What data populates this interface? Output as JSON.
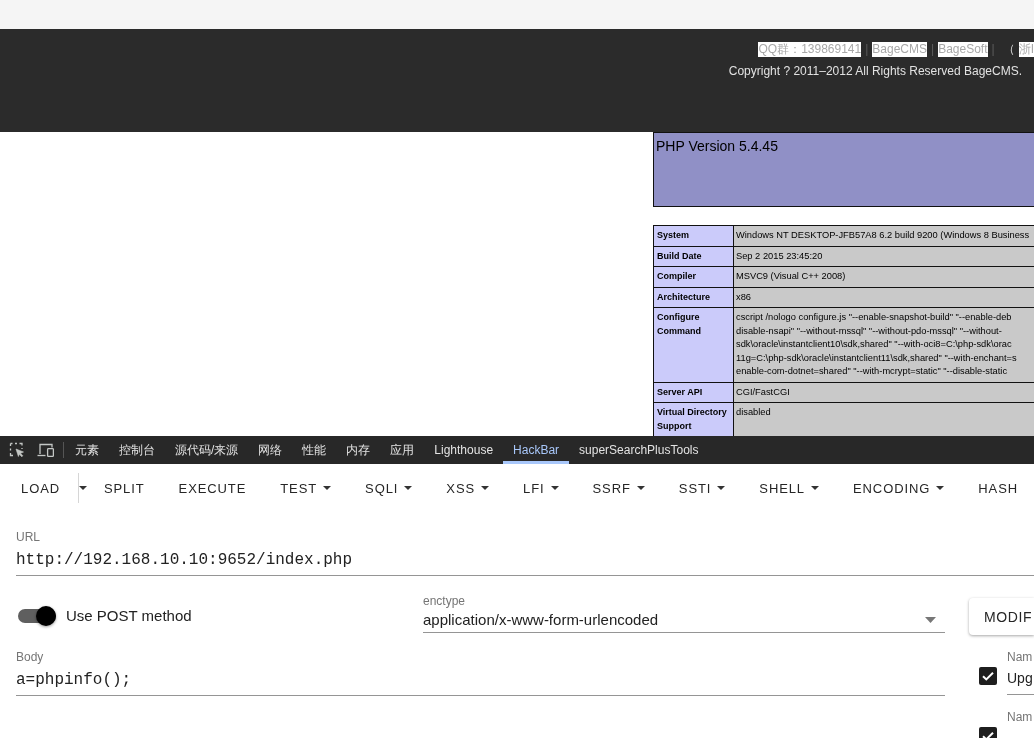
{
  "footer": {
    "links_line": [
      {
        "kind": "link",
        "text": "QQ群：139869141"
      },
      {
        "kind": "separator",
        "text": "|"
      },
      {
        "kind": "link",
        "text": "BageCMS"
      },
      {
        "kind": "separator",
        "text": "|"
      },
      {
        "kind": "link",
        "text": "BageSoft"
      },
      {
        "kind": "separator",
        "text": "|"
      },
      {
        "kind": "text",
        "text": "（"
      },
      {
        "kind": "link",
        "text": "浙I"
      }
    ],
    "copyright": "Copyright ? 2011–2012 All Rights Reserved BageCMS."
  },
  "phpinfo": {
    "title": "PHP Version 5.4.45",
    "rows": [
      {
        "label": "System",
        "lines": [
          "Windows NT DESKTOP-JFB57A8 6.2 build 9200 (Windows 8 Business"
        ]
      },
      {
        "label": "Build Date",
        "lines": [
          "Sep 2 2015 23:45:20"
        ]
      },
      {
        "label": "Compiler",
        "lines": [
          "MSVC9 (Visual C++ 2008)"
        ]
      },
      {
        "label": "Architecture",
        "lines": [
          "x86"
        ]
      },
      {
        "label": "Configure Command",
        "lines": [
          "cscript /nologo configure.js \"--enable-snapshot-build\" \"--enable-deb",
          "disable-nsapi\" \"--without-mssql\" \"--without-pdo-mssql\" \"--without-",
          "sdk\\oracle\\instantclient10\\sdk,shared\" \"--with-oci8=C:\\php-sdk\\orac",
          "11g=C:\\php-sdk\\oracle\\instantclient11\\sdk,shared\" \"--with-enchant=s",
          "enable-com-dotnet=shared\" \"--with-mcrypt=static\" \"--disable-static"
        ]
      },
      {
        "label": "Server API",
        "lines": [
          "CGI/FastCGI"
        ]
      },
      {
        "label": "Virtual Directory Support",
        "lines": [
          "disabled"
        ]
      }
    ]
  },
  "devtools": {
    "tabs": [
      {
        "label": "元素",
        "selected": false
      },
      {
        "label": "控制台",
        "selected": false
      },
      {
        "label": "源代码/来源",
        "selected": false
      },
      {
        "label": "网络",
        "selected": false
      },
      {
        "label": "性能",
        "selected": false
      },
      {
        "label": "内存",
        "selected": false
      },
      {
        "label": "应用",
        "selected": false
      },
      {
        "label": "Lighthouse",
        "selected": false
      },
      {
        "label": "HackBar",
        "selected": true
      },
      {
        "label": "superSearchPlusTools",
        "selected": false
      }
    ]
  },
  "hackbar": {
    "toolbar": [
      {
        "kind": "split",
        "label": "LOAD"
      },
      {
        "kind": "plain",
        "label": "SPLIT"
      },
      {
        "kind": "plain",
        "label": "EXECUTE"
      },
      {
        "kind": "menu",
        "label": "TEST"
      },
      {
        "kind": "menu",
        "label": "SQLI"
      },
      {
        "kind": "menu",
        "label": "XSS"
      },
      {
        "kind": "menu",
        "label": "LFI"
      },
      {
        "kind": "menu",
        "label": "SSRF"
      },
      {
        "kind": "menu",
        "label": "SSTI"
      },
      {
        "kind": "menu",
        "label": "SHELL"
      },
      {
        "kind": "menu",
        "label": "ENCODING"
      },
      {
        "kind": "plain",
        "label": "HASH"
      }
    ],
    "url": {
      "label": "URL",
      "value": "http://192.168.10.10:9652/index.php"
    },
    "post_method": {
      "label": "Use POST method",
      "on": true
    },
    "enctype": {
      "label": "enctype",
      "value": "application/x-www-form-urlencoded"
    },
    "body": {
      "label": "Body",
      "value": "a=phpinfo();"
    },
    "modify_button": "MODIF",
    "headers": [
      {
        "checked": true,
        "name_label": "Nam",
        "value": "Upg"
      },
      {
        "checked": true,
        "name_label": "Nam"
      }
    ]
  }
}
